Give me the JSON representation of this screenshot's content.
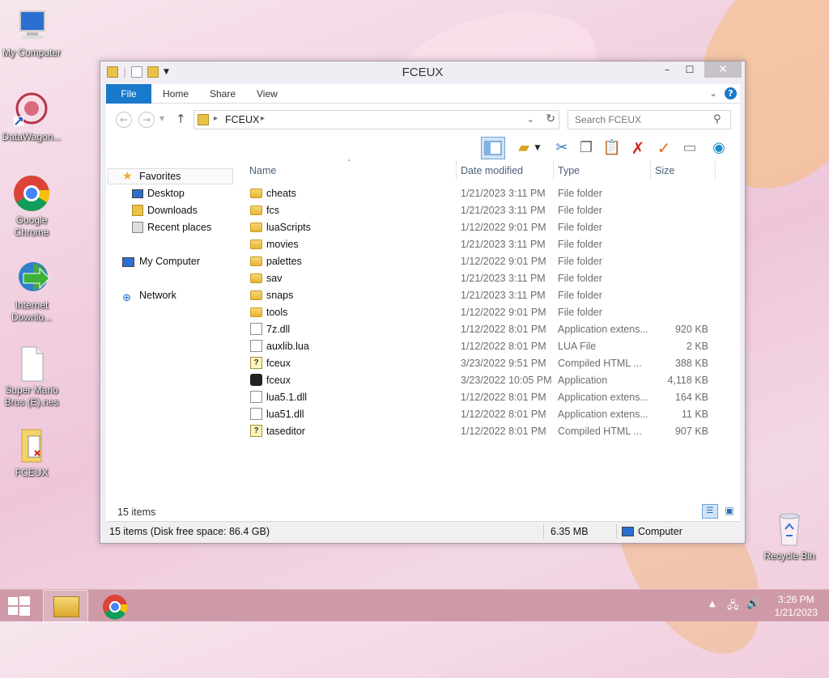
{
  "desktop": {
    "icons": [
      {
        "label": "My Computer",
        "icon": "computer-icon"
      },
      {
        "label": "DataWagon...",
        "icon": "datawagon-icon"
      },
      {
        "label": "Google Chrome",
        "icon": "chrome-icon"
      },
      {
        "label": "Internet Downlo...",
        "icon": "idm-icon"
      },
      {
        "label": "Super Mario Bros (E).nes",
        "icon": "file-icon"
      },
      {
        "label": "FCEUX",
        "icon": "folder-shortcut-icon"
      },
      {
        "label": "Recycle Bin",
        "icon": "recycle-bin-icon"
      }
    ]
  },
  "window": {
    "title": "FCEUX",
    "controls": {
      "minimize": "–",
      "maximize": "☐",
      "close": "✕"
    },
    "ribbon": {
      "tabs": [
        "File",
        "Home",
        "Share",
        "View"
      ]
    },
    "address": {
      "path": "FCEUX"
    },
    "search": {
      "placeholder": "Search FCEUX"
    },
    "nav": {
      "favorites": "Favorites",
      "favorites_items": [
        "Desktop",
        "Downloads",
        "Recent places"
      ],
      "computer": "My Computer",
      "network": "Network"
    },
    "columns": {
      "name": "Name",
      "date": "Date modified",
      "type": "Type",
      "size": "Size"
    },
    "files": [
      {
        "name": "cheats",
        "date": "1/21/2023 3:11 PM",
        "type": "File folder",
        "size": "",
        "icon": "folder-icon"
      },
      {
        "name": "fcs",
        "date": "1/21/2023 3:11 PM",
        "type": "File folder",
        "size": "",
        "icon": "folder-icon"
      },
      {
        "name": "luaScripts",
        "date": "1/12/2022 9:01 PM",
        "type": "File folder",
        "size": "",
        "icon": "folder-icon"
      },
      {
        "name": "movies",
        "date": "1/21/2023 3:11 PM",
        "type": "File folder",
        "size": "",
        "icon": "folder-icon"
      },
      {
        "name": "palettes",
        "date": "1/12/2022 9:01 PM",
        "type": "File folder",
        "size": "",
        "icon": "folder-icon"
      },
      {
        "name": "sav",
        "date": "1/21/2023 3:11 PM",
        "type": "File folder",
        "size": "",
        "icon": "folder-icon"
      },
      {
        "name": "snaps",
        "date": "1/21/2023 3:11 PM",
        "type": "File folder",
        "size": "",
        "icon": "folder-icon"
      },
      {
        "name": "tools",
        "date": "1/12/2022 9:01 PM",
        "type": "File folder",
        "size": "",
        "icon": "folder-icon"
      },
      {
        "name": "7z.dll",
        "date": "1/12/2022 8:01 PM",
        "type": "Application extens...",
        "size": "920 KB",
        "icon": "dll-icon"
      },
      {
        "name": "auxlib.lua",
        "date": "1/12/2022 8:01 PM",
        "type": "LUA File",
        "size": "2 KB",
        "icon": "file-icon"
      },
      {
        "name": "fceux",
        "date": "3/23/2022 9:51 PM",
        "type": "Compiled HTML ...",
        "size": "388 KB",
        "icon": "help-file-icon"
      },
      {
        "name": "fceux",
        "date": "3/23/2022 10:05 PM",
        "type": "Application",
        "size": "4,118 KB",
        "icon": "app-icon"
      },
      {
        "name": "lua5.1.dll",
        "date": "1/12/2022 8:01 PM",
        "type": "Application extens...",
        "size": "164 KB",
        "icon": "dll-icon"
      },
      {
        "name": "lua51.dll",
        "date": "1/12/2022 8:01 PM",
        "type": "Application extens...",
        "size": "11 KB",
        "icon": "dll-icon"
      },
      {
        "name": "taseditor",
        "date": "1/12/2022 8:01 PM",
        "type": "Compiled HTML ...",
        "size": "907 KB",
        "icon": "help-file-icon"
      }
    ],
    "item_count": "15 items",
    "status": {
      "info": "15 items (Disk free space: 86.4 GB)",
      "size": "6.35 MB",
      "location": "Computer"
    }
  },
  "taskbar": {
    "time": "3:26 PM",
    "date": "1/21/2023"
  },
  "colors": {
    "accent": "#1979ca",
    "taskbar": "#cf9aa7"
  }
}
